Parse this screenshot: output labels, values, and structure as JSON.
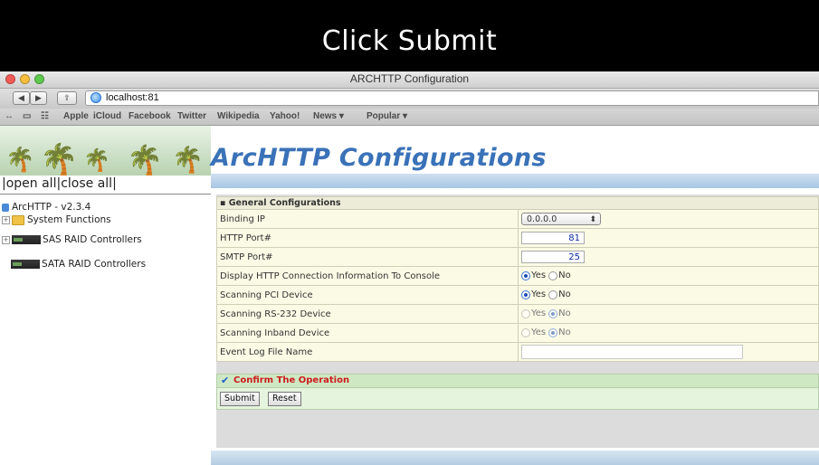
{
  "caption": "Click Submit",
  "window": {
    "title": "ARCHTTP Configuration"
  },
  "toolbar": {
    "back": "◀",
    "forward": "▶",
    "share": "⇪",
    "url": "localhost:81"
  },
  "bookmarks": [
    "Apple",
    "iCloud",
    "Facebook",
    "Twitter",
    "Wikipedia",
    "Yahoo!",
    "News ▾",
    "Popular ▾"
  ],
  "left_nav": {
    "open_all": "open all",
    "close_all": "close all",
    "tree": {
      "root": "ArcHTTP - v2.3.4",
      "system_functions": "System Functions",
      "sas": "SAS RAID Controllers",
      "sata": "SATA RAID Controllers"
    }
  },
  "main": {
    "title": "ArcHTTP Configurations",
    "section_header": "General Configurations",
    "rows": {
      "binding_ip": {
        "label": "Binding IP",
        "value": "0.0.0.0"
      },
      "http_port": {
        "label": "HTTP Port#",
        "value": "81"
      },
      "smtp_port": {
        "label": "SMTP Port#",
        "value": "25"
      },
      "display_http": {
        "label": "Display HTTP Connection Information To Console",
        "yes": "Yes",
        "no": "No",
        "selected": "Yes"
      },
      "scan_pci": {
        "label": "Scanning PCI Device",
        "yes": "Yes",
        "no": "No",
        "selected": "Yes"
      },
      "scan_rs232": {
        "label": "Scanning RS-232 Device",
        "yes": "Yes",
        "no": "No",
        "selected": "No"
      },
      "scan_inband": {
        "label": "Scanning Inband Device",
        "yes": "Yes",
        "no": "No",
        "selected": "No"
      },
      "event_log": {
        "label": "Event Log File Name",
        "value": ""
      }
    },
    "confirm_label": "Confirm The Operation",
    "submit_label": "Submit",
    "reset_label": "Reset"
  }
}
